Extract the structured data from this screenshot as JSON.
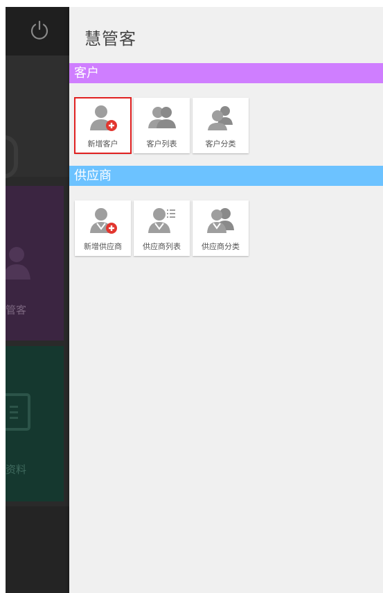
{
  "background": {
    "tile1_label": "管客",
    "tile2_label": "资料"
  },
  "panel": {
    "title": "慧管客"
  },
  "sections": {
    "customer": {
      "header": "客户",
      "color": "#cf7eff",
      "items": [
        {
          "label": "新增客户",
          "icon": "add-person-icon",
          "selected": true
        },
        {
          "label": "客户列表",
          "icon": "people-icon",
          "selected": false
        },
        {
          "label": "客户分类",
          "icon": "categorize-people-icon",
          "selected": false
        }
      ]
    },
    "supplier": {
      "header": "供应商",
      "color": "#6cc2ff",
      "items": [
        {
          "label": "新增供应商",
          "icon": "add-supplier-icon",
          "selected": false
        },
        {
          "label": "供应商列表",
          "icon": "supplier-list-icon",
          "selected": false
        },
        {
          "label": "供应商分类",
          "icon": "supplier-group-icon",
          "selected": false
        }
      ]
    }
  }
}
